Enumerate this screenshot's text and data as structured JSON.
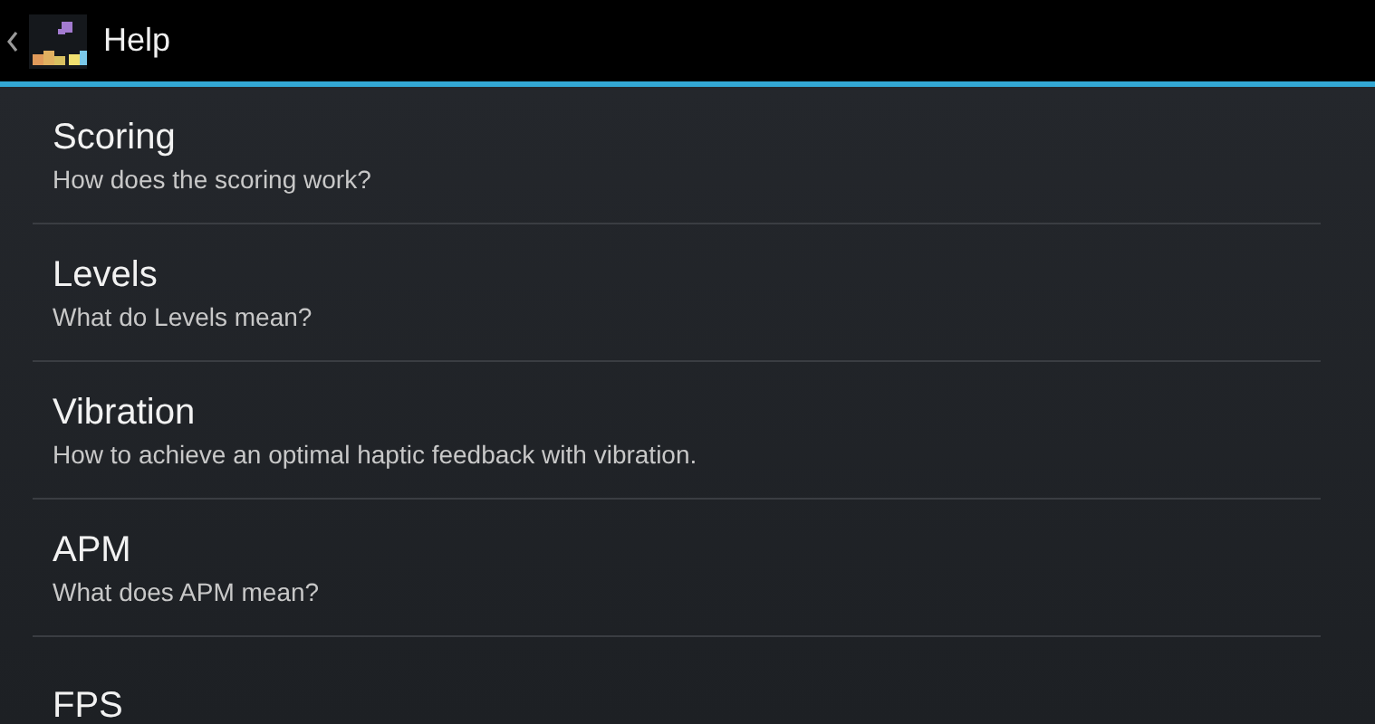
{
  "action_bar": {
    "title": "Help"
  },
  "items": [
    {
      "title": "Scoring",
      "subtitle": "How does the scoring work?"
    },
    {
      "title": "Levels",
      "subtitle": "What do Levels mean?"
    },
    {
      "title": "Vibration",
      "subtitle": "How to achieve an optimal haptic feedback with vibration."
    },
    {
      "title": "APM",
      "subtitle": "What does APM mean?"
    },
    {
      "title": "FPS"
    }
  ]
}
